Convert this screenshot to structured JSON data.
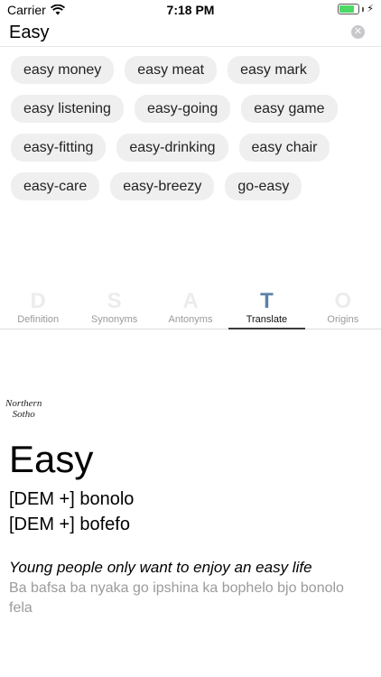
{
  "status_bar": {
    "carrier": "Carrier",
    "time": "7:18 PM",
    "icons": [
      "wifi-icon",
      "battery-icon",
      "charging-bolt-icon"
    ],
    "battery_level": 0.8
  },
  "search": {
    "value": "Easy",
    "clear_icon": "clear-circle-icon"
  },
  "suggestions": [
    "easy money",
    "easy meat",
    "easy mark",
    "easy listening",
    "easy-going",
    "easy game",
    "easy-fitting",
    "easy-drinking",
    "easy chair",
    "easy-care",
    "easy-breezy",
    "go-easy"
  ],
  "tabs": [
    {
      "letter": "D",
      "label": "Definition"
    },
    {
      "letter": "S",
      "label": "Synonyms"
    },
    {
      "letter": "A",
      "label": "Antonyms"
    },
    {
      "letter": "T",
      "label": "Translate"
    },
    {
      "letter": "O",
      "label": "Origins"
    }
  ],
  "active_tab": "Translate",
  "colors": {
    "active_tab_letter": "#5b81a6",
    "inactive_tab_letter": "#ececec",
    "chip_background": "#efefef",
    "battery": "#4cd964"
  },
  "content": {
    "language_logo": [
      "Northern",
      "Sotho"
    ],
    "headword": "Easy",
    "translations": [
      "[DEM +] bonolo",
      "[DEM +] bofefo"
    ],
    "example_en": "Young people only want to enjoy an easy life",
    "example_translation": "Ba bafsa ba nyaka go ipshina ka bophelo bjo bonolo fela"
  }
}
